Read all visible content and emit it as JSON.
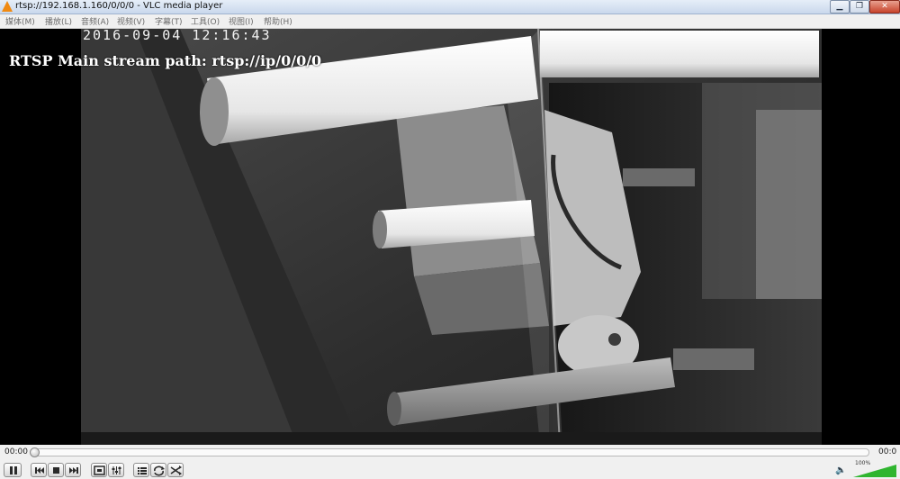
{
  "window": {
    "title": "rtsp://192.168.1.160/0/0/0 - VLC media player",
    "minimize_glyph": "▁",
    "maximize_glyph": "❐",
    "close_glyph": "✕"
  },
  "menu": [
    {
      "label": "媒体(M)"
    },
    {
      "label": "播放(L)"
    },
    {
      "label": "音频(A)"
    },
    {
      "label": "视频(V)"
    },
    {
      "label": "字幕(T)"
    },
    {
      "label": "工具(O)"
    },
    {
      "label": "视图(I)"
    },
    {
      "label": "帮助(H)"
    }
  ],
  "video": {
    "timestamp": "2016-09-04  12:16:43",
    "overlay_text": "RTSP Main stream path: rtsp://ip/0/0/0"
  },
  "seek": {
    "elapsed": "00:00",
    "remaining": "00:0",
    "position": 0
  },
  "controls": {
    "buttons": [
      "pause-icon",
      "previous-icon",
      "stop-icon",
      "next-icon",
      "fullscreen-icon",
      "extended-settings-icon",
      "playlist-icon",
      "loop-icon",
      "shuffle-icon"
    ]
  },
  "volume": {
    "label": "100%",
    "level": 1.0,
    "speaker_glyph": "🔈",
    "accent": "#2fb52f"
  }
}
